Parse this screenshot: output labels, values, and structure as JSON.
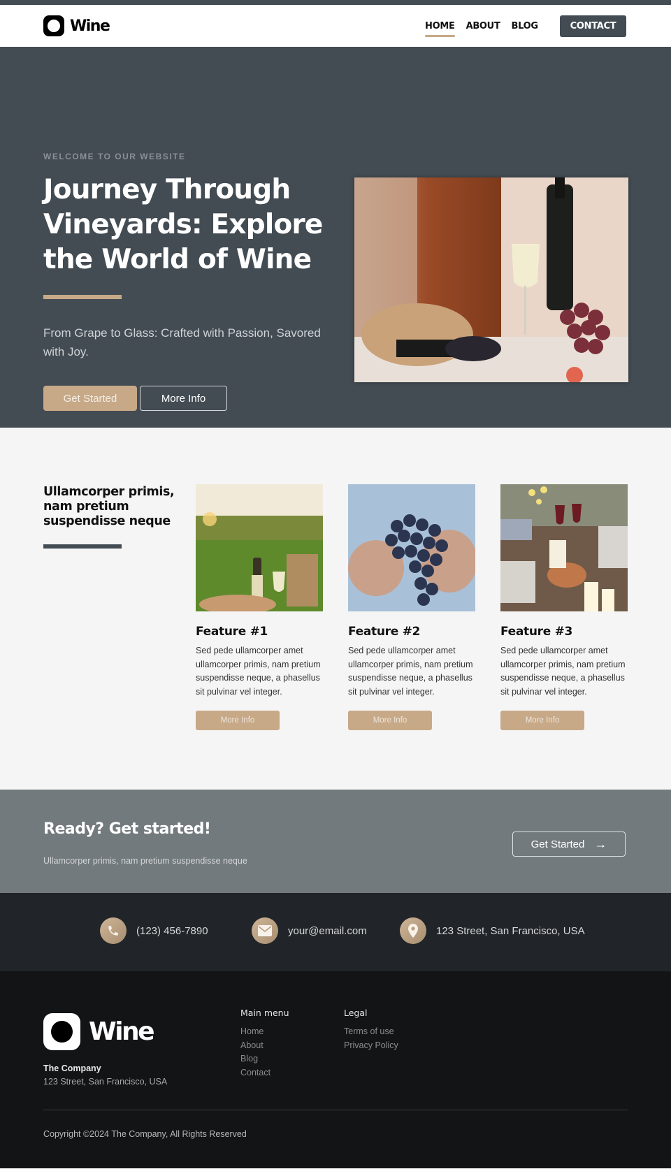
{
  "header": {
    "brand": "Wine",
    "nav": [
      {
        "label": "HOME",
        "active": true
      },
      {
        "label": "ABOUT",
        "active": false
      },
      {
        "label": "BLOG",
        "active": false
      }
    ],
    "contact_label": "CONTACT"
  },
  "hero": {
    "eyebrow": "WELCOME TO OUR WEBSITE",
    "title": "Journey Through Vineyards: Explore the World of Wine",
    "subtitle": "From Grape to Glass: Crafted with Passion, Savored with Joy.",
    "primary_label": "Get Started",
    "secondary_label": "More Info",
    "image_alt": "Wine bottle, glass of white wine, straw hat, blackberries and red grapes on a table"
  },
  "features": {
    "heading": "Ullamcorper primis, nam pretium suspendisse neque",
    "cards": [
      {
        "title": "Feature #1",
        "text": "Sed pede ullamcorper amet ullamcorper primis, nam pretium suspendisse neque, a phasellus sit pulvinar vel integer.",
        "button": "More Info",
        "image_alt": "Picnic with wine in a field at sunset"
      },
      {
        "title": "Feature #2",
        "text": "Sed pede ullamcorper amet ullamcorper primis, nam pretium suspendisse neque, a phasellus sit pulvinar vel integer.",
        "button": "More Info",
        "image_alt": "Hands holding a bunch of dark grapes"
      },
      {
        "title": "Feature #3",
        "text": "Sed pede ullamcorper amet ullamcorper primis, nam pretium suspendisse neque, a phasellus sit pulvinar vel integer.",
        "button": "More Info",
        "image_alt": "Friends toasting red wine at a dinner table"
      }
    ]
  },
  "cta": {
    "title": "Ready? Get started!",
    "subtitle": "Ullamcorper primis, nam pretium suspendisse neque",
    "button": "Get Started",
    "button_icon": "→"
  },
  "contact": {
    "phone": "(123) 456-7890",
    "email": "your@email.com",
    "address": "123 Street, San Francisco, USA"
  },
  "footer": {
    "brand": "Wine",
    "company": "The Company",
    "address": "123 Street, San Francisco, USA",
    "main_menu": {
      "title": "Main menu",
      "links": [
        "Home",
        "About",
        "Blog",
        "Contact"
      ]
    },
    "legal": {
      "title": "Legal",
      "links": [
        "Terms of use",
        "Privacy Policy"
      ]
    },
    "copyright": "Copyright ©2024 The Company, All Rights Reserved"
  },
  "colors": {
    "accent": "#c7a988",
    "dark_slate": "#434c53",
    "cta_gray": "#737a7e",
    "contact_bg": "#212529",
    "footer_bg": "#131416"
  }
}
